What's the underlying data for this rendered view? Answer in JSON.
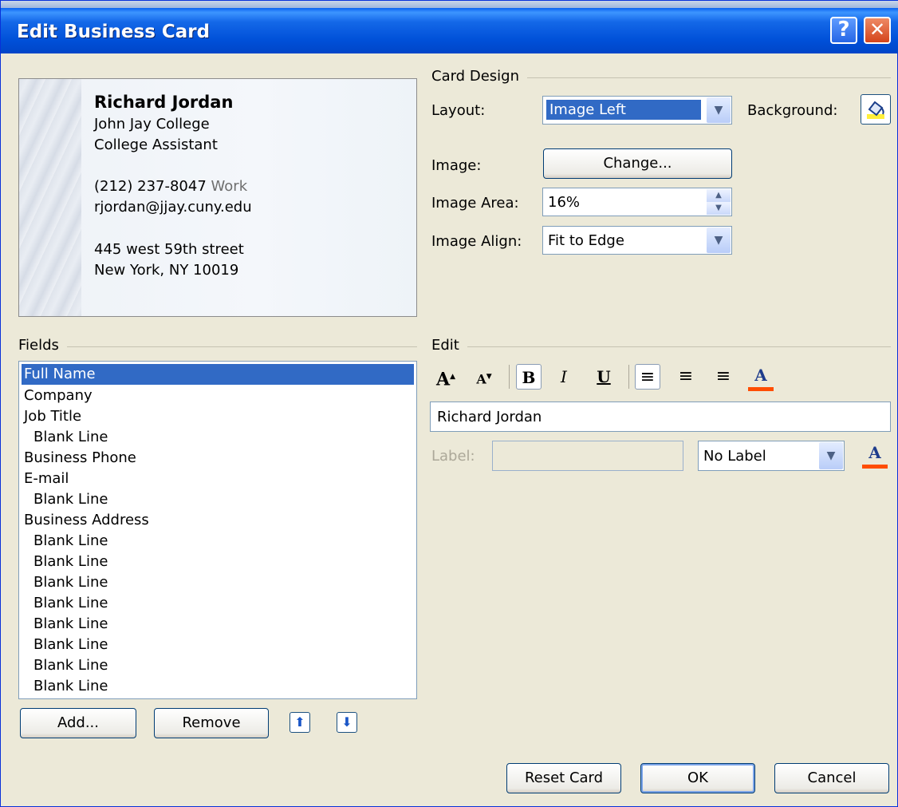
{
  "window": {
    "title": "Edit Business Card",
    "help_glyph": "?",
    "close_glyph": "✕"
  },
  "card": {
    "name": "Richard Jordan",
    "company": "John Jay College",
    "job_title": "College Assistant",
    "phone": "(212) 237-8047",
    "phone_label": "Work",
    "email": "rjordan@jjay.cuny.edu",
    "address_line1": "445 west 59th street",
    "address_line2": "New York, NY 10019"
  },
  "card_design": {
    "heading": "Card Design",
    "layout_label": "Layout:",
    "layout_value": "Image Left",
    "background_label": "Background:",
    "image_label": "Image:",
    "change_button": "Change...",
    "image_area_label": "Image Area:",
    "image_area_value": "16%",
    "image_align_label": "Image Align:",
    "image_align_value": "Fit to Edge"
  },
  "fields": {
    "heading": "Fields",
    "items": [
      "Full Name",
      "Company",
      "Job Title",
      "Blank Line",
      "Business Phone",
      "E-mail",
      "Blank Line",
      "Business Address",
      "Blank Line",
      "Blank Line",
      "Blank Line",
      "Blank Line",
      "Blank Line",
      "Blank Line",
      "Blank Line",
      "Blank Line"
    ],
    "selected_index": 0,
    "add_button": "Add...",
    "remove_button": "Remove"
  },
  "edit": {
    "heading": "Edit",
    "value": "Richard Jordan",
    "label_caption": "Label:",
    "label_value": "",
    "label_select": "No Label"
  },
  "footer": {
    "reset_button": "Reset Card",
    "ok_button": "OK",
    "cancel_button": "Cancel"
  },
  "colors": {
    "titlebar": "#0058ee",
    "selection": "#316ac5",
    "dialog_bg": "#ece9d8",
    "font_color_bar": "#ff4d00"
  }
}
